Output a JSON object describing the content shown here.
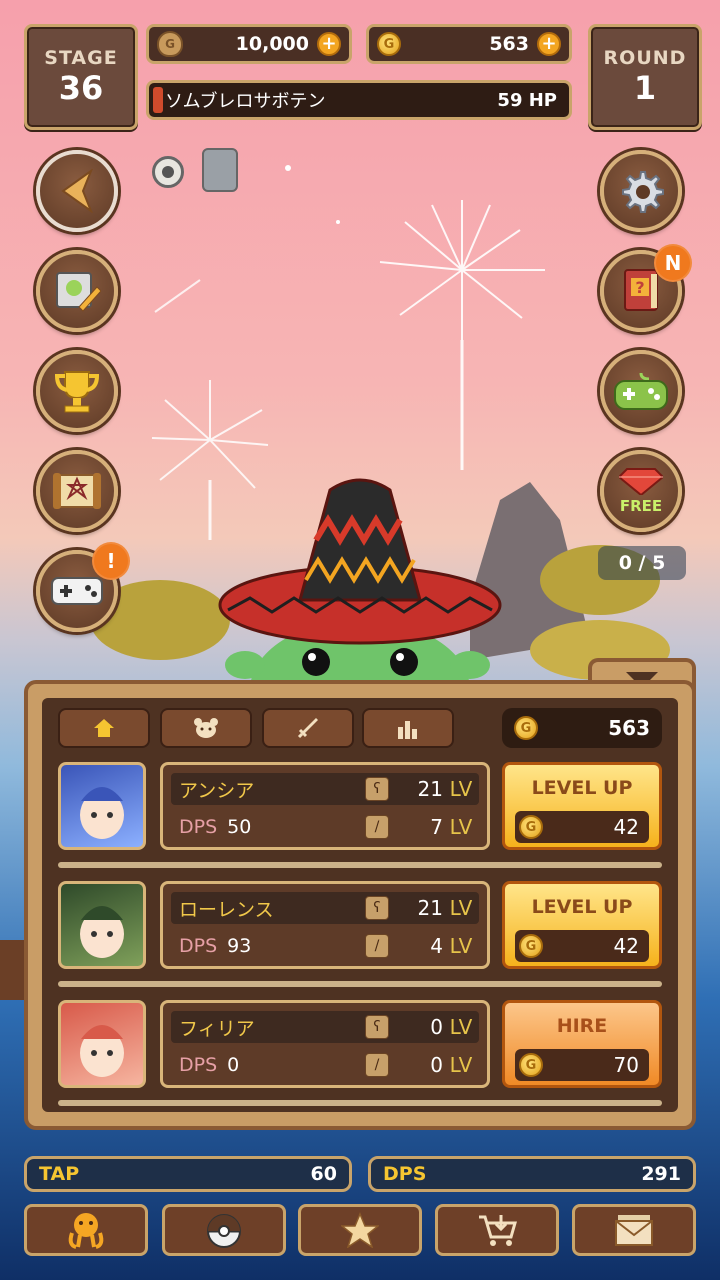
{
  "hud": {
    "stage_label": "STAGE",
    "stage_value": "36",
    "bag_value": "10,000",
    "gold_value": "563",
    "round_label": "ROUND",
    "round_value": "1",
    "enemy_name": "ソムブレロサボテン",
    "enemy_hp": "59 HP"
  },
  "side": {
    "counter": "0 / 5",
    "new_badge": "N",
    "alert_badge": "!",
    "free_label": "FREE"
  },
  "panel": {
    "gold": "563",
    "heroes": [
      {
        "name": "アンシア",
        "dps_label": "DPS",
        "dps": "50",
        "lv1": "21",
        "lv2": "7",
        "lv_unit": "LV",
        "action": "LEVEL UP",
        "cost": "42"
      },
      {
        "name": "ローレンス",
        "dps_label": "DPS",
        "dps": "93",
        "lv1": "21",
        "lv2": "4",
        "lv_unit": "LV",
        "action": "LEVEL UP",
        "cost": "42"
      },
      {
        "name": "フィリア",
        "dps_label": "DPS",
        "dps": "0",
        "lv1": "0",
        "lv2": "0",
        "lv_unit": "LV",
        "action": "HIRE",
        "cost": "70"
      }
    ]
  },
  "bottom": {
    "tap_label": "TAP",
    "tap_value": "60",
    "dps_label": "DPS",
    "dps_value": "291"
  },
  "colors": {
    "accent": "#f5c531",
    "frame": "#c9a46a",
    "panel": "#4e3222"
  }
}
